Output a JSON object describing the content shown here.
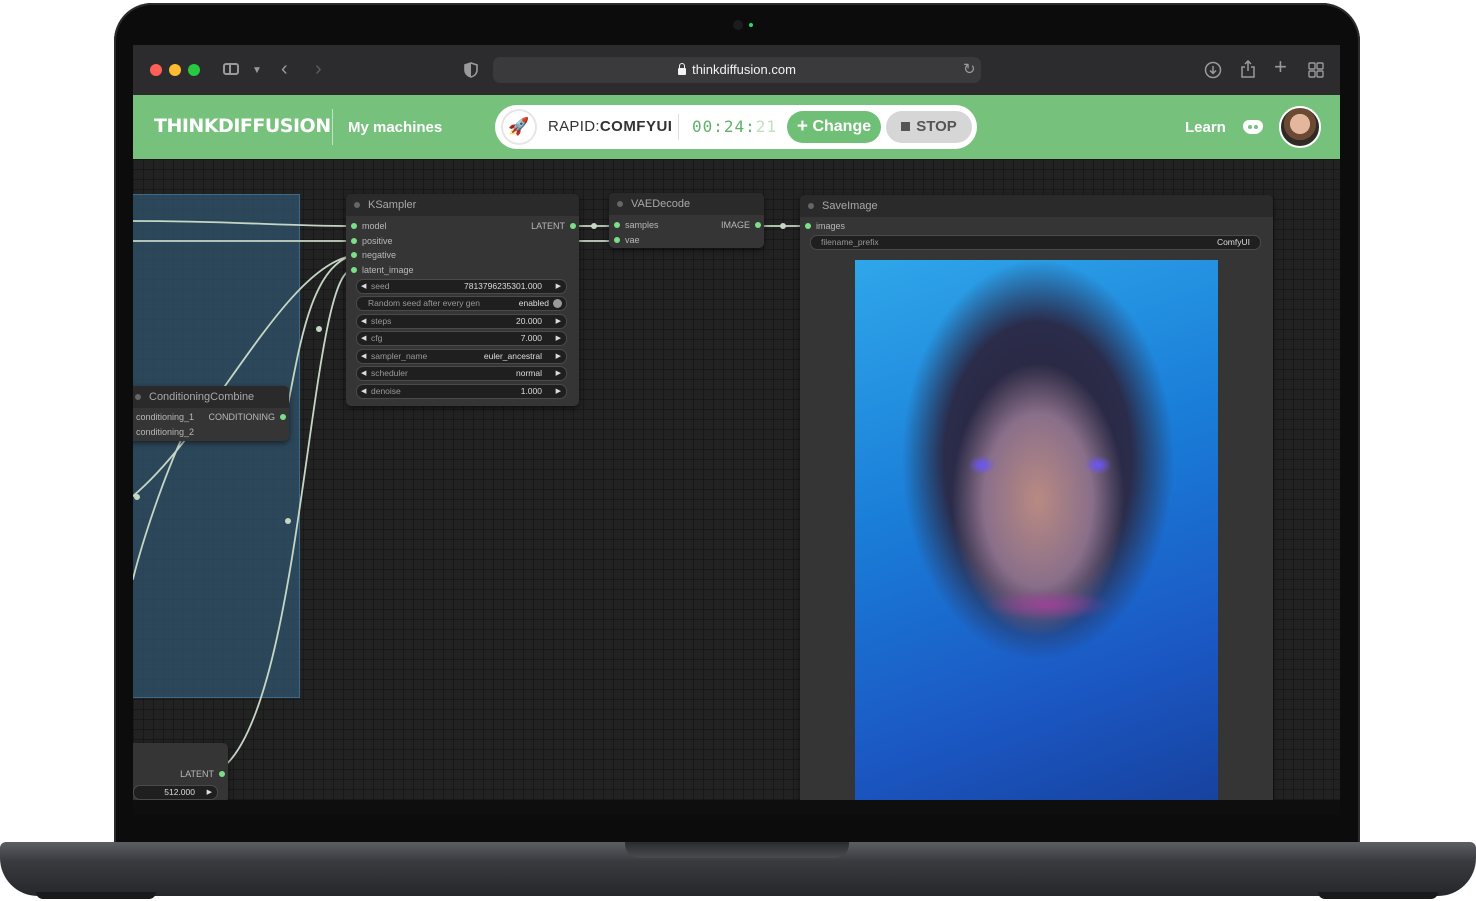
{
  "browser": {
    "url": "thinkdiffusion.com"
  },
  "header": {
    "logo_text": "THINKDIFFUSION",
    "my_machines": "My machines",
    "machine_prefix": "RAPID:",
    "machine_name": "COMFYUI",
    "timer_main": "00:24:",
    "timer_dim": "21",
    "change_label": "Change",
    "stop_label": "STOP",
    "learn_label": "Learn"
  },
  "colors": {
    "brand_green": "#76c27d",
    "slot_green": "#7dde8a",
    "canvas_bg": "#222222"
  },
  "nodes": {
    "ksampler": {
      "title": "KSampler",
      "inputs": [
        "model",
        "positive",
        "negative",
        "latent_image"
      ],
      "output": "LATENT",
      "widgets": [
        {
          "label": "seed",
          "value": "7813796235301.000"
        },
        {
          "label": "Random seed after every gen",
          "value": "enabled"
        },
        {
          "label": "steps",
          "value": "20.000"
        },
        {
          "label": "cfg",
          "value": "7.000"
        },
        {
          "label": "sampler_name",
          "value": "euler_ancestral"
        },
        {
          "label": "scheduler",
          "value": "normal"
        },
        {
          "label": "denoise",
          "value": "1.000"
        }
      ]
    },
    "vaedecode": {
      "title": "VAEDecode",
      "inputs": [
        "samples",
        "vae"
      ],
      "output": "IMAGE"
    },
    "saveimage": {
      "title": "SaveImage",
      "inputs": [
        "images"
      ],
      "widget_label": "filename_prefix",
      "widget_value": "ComfyUI"
    },
    "conditioning_combine": {
      "title": "ConditioningCombine",
      "inputs": [
        "conditioning_1",
        "conditioning_2"
      ],
      "output": "CONDITIONING"
    },
    "latent_node": {
      "output": "LATENT",
      "widget_value": "512.000"
    }
  },
  "icons": [
    "sidebar-icon",
    "back-icon",
    "forward-icon",
    "shield-icon",
    "lock-icon",
    "reload-icon",
    "download-icon",
    "share-icon",
    "new-tab-icon",
    "tab-overview-icon",
    "rocket-icon",
    "discord-icon"
  ]
}
